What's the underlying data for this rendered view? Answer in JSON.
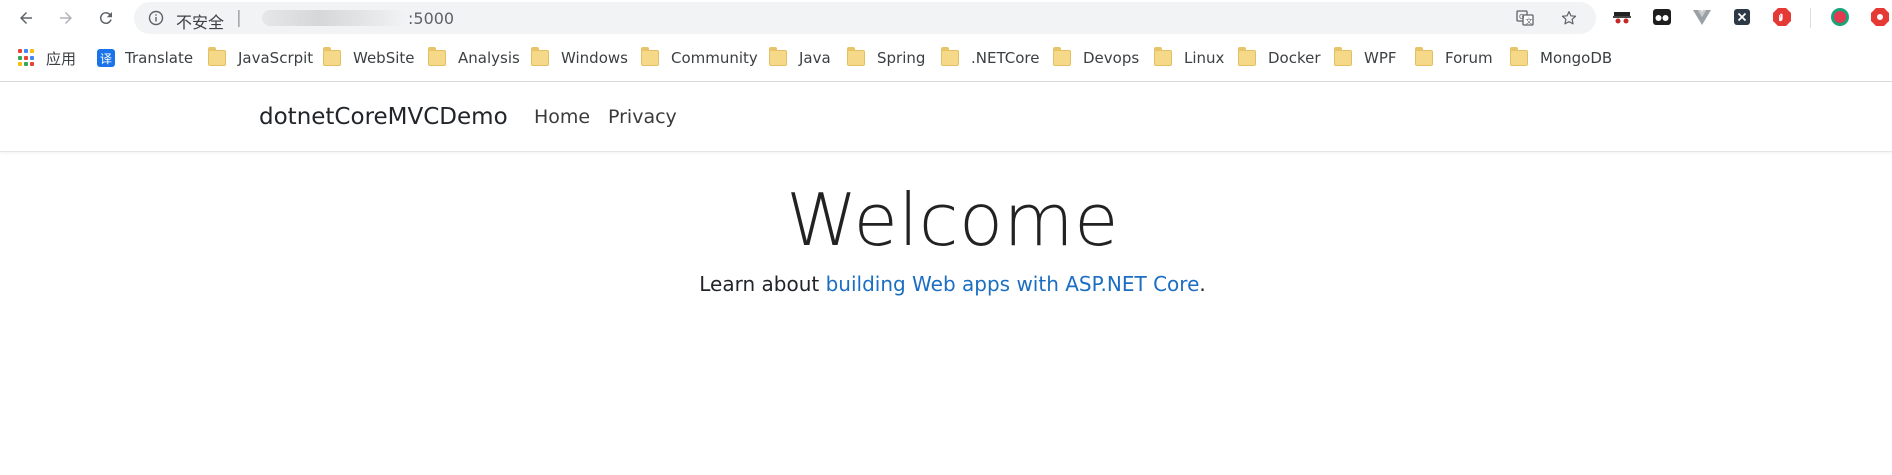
{
  "browser": {
    "security_label": "不安全",
    "separator": "|",
    "url_visible": ":5000",
    "icons": {
      "back": "back-arrow-icon",
      "forward": "forward-arrow-icon",
      "reload": "reload-icon",
      "info": "info-icon",
      "translate": "translate-page-icon",
      "bookmark_star": "star-icon"
    }
  },
  "extensions": [
    "incognito-ext-icon",
    "glasses-ext-icon",
    "vue-ext-icon",
    "x-ext-icon",
    "adblock-ext-icon",
    "profile-ext-icon",
    "stop-ext-icon"
  ],
  "bookmarks": {
    "apps_label": "应用",
    "translate_label": "Translate",
    "translate_glyph": "译",
    "folders": [
      "JavaScrpit",
      "WebSite",
      "Analysis",
      "Windows",
      "Community",
      "Java",
      "Spring",
      ".NETCore",
      "Devops",
      "Linux",
      "Docker",
      "WPF",
      "Forum",
      "MongoDB"
    ]
  },
  "site": {
    "brand": "dotnetCoreMVCDemo",
    "nav": [
      "Home",
      "Privacy"
    ]
  },
  "main": {
    "title": "Welcome",
    "lead_prefix": "Learn about ",
    "lead_link": "building Web apps with ASP.NET Core",
    "lead_suffix": "."
  },
  "colors": {
    "link": "#1b6ec2",
    "omnibox_bg": "#f1f3f4",
    "folder": "#f6d889"
  }
}
